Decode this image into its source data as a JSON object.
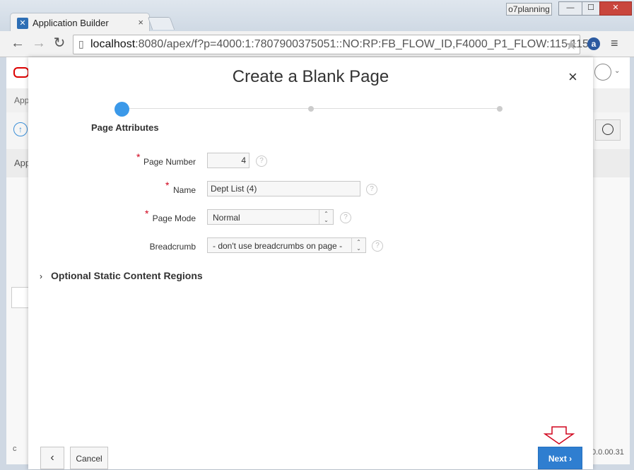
{
  "browser": {
    "tab_title": "Application Builder",
    "tab_close": "×",
    "profile_name": "o7planning",
    "window_controls": [
      "—",
      "☐",
      "✕"
    ],
    "back_icon": "←",
    "forward_icon": "→",
    "reload_icon": "↻",
    "url_host": "localhost",
    "url_rest": ":8080/apex/f?p=4000:1:7807900375051::NO:RP:FB_FLOW_ID,F4000_P1_FLOW:115,115",
    "star_icon": "★",
    "ext_label": "a",
    "menu_icon": "≡"
  },
  "background": {
    "tab_text": "App",
    "section_text": "App",
    "footer_left": "c",
    "version": "0.0.00.31",
    "up_icon": "↑"
  },
  "dialog": {
    "title": "Create a Blank Page",
    "close_icon": "×",
    "wizard": {
      "current_step_label": "Page Attributes",
      "total_steps": 3,
      "current_step": 1
    },
    "fields": {
      "page_number": {
        "label": "Page Number",
        "value": "4",
        "required": true
      },
      "name": {
        "label": "Name",
        "value": "Dept List (4)",
        "required": true
      },
      "page_mode": {
        "label": "Page Mode",
        "value": "Normal",
        "required": true
      },
      "breadcrumb": {
        "label": "Breadcrumb",
        "value": "- don't use breadcrumbs on page -",
        "required": false
      }
    },
    "required_mark": "*",
    "help_icon": "?",
    "optional_section": {
      "chevron": "›",
      "label": "Optional Static Content Regions"
    },
    "footer": {
      "back_icon": "‹",
      "cancel_label": "Cancel",
      "next_label": "Next",
      "next_icon": "›"
    }
  },
  "colors": {
    "accent": "#3b99e9",
    "next_button": "#2f7ed0",
    "required": "#d0021b",
    "annotation_arrow": "#d0021b"
  }
}
